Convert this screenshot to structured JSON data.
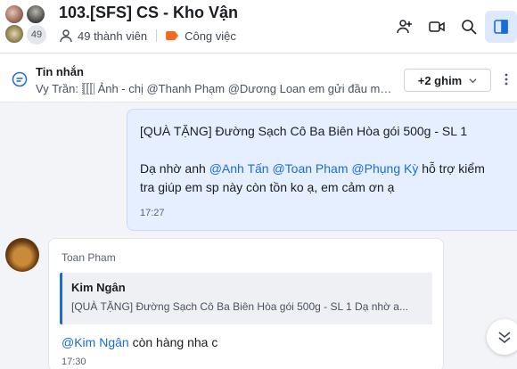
{
  "header": {
    "title": "103.[SFS] CS - Kho Vận",
    "member_count_badge": "49",
    "members_label": "49 thành viên",
    "category_label": "Công việc",
    "category_color": "#f26b1d",
    "icons": [
      "add-member-icon",
      "video-call-icon",
      "search-icon",
      "sidebar-toggle-icon"
    ]
  },
  "pinned": {
    "title": "Tin nhắn",
    "preview_author": "Vy Trần:",
    "preview_text": "Ảnh - chị @Thanh Phạm @Dương Loan em gửi đầu mối...",
    "pin_button_label": "+2 ghim"
  },
  "messages": {
    "mine": {
      "line1": "[QUÀ TẶNG] Đường Sạch Cô Ba Biên Hòa gói 500g - SL 1",
      "line2_prefix": "Dạ nhờ anh ",
      "mention1": "@Anh Tấn",
      "mention2": "@Toan Pham",
      "mention3": "@Phụng Kỳ",
      "line2_suffix": " hỗ trợ kiểm",
      "line3": "tra giúp em sp này còn tồn ko ạ, em cảm ơn ạ",
      "time": "17:27"
    },
    "other": {
      "sender": "Toan Pham",
      "quote_author": "Kim Ngân",
      "quote_text": "[QUÀ TẶNG] Đường Sạch Cô Ba Biên Hòa gói 500g - SL 1 Dạ nhờ a...",
      "reply_mention": "@Kim Ngân",
      "reply_text": " còn hàng nha c",
      "time": "17:30"
    }
  },
  "colors": {
    "accent": "#1a6bd8",
    "my_bubble": "#e5efff"
  }
}
